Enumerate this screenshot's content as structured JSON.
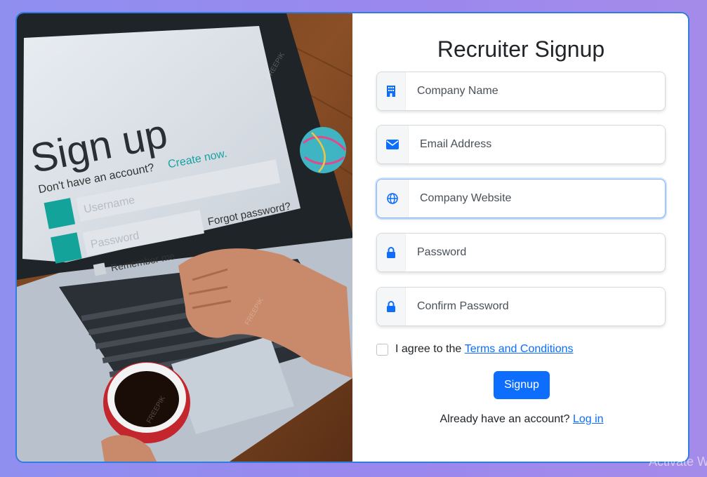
{
  "illustration": {
    "screen_title": "Sign up",
    "screen_subtitle": "Don't have an account?",
    "screen_link": "Create now.",
    "screen_username": "Username",
    "screen_password": "Password",
    "screen_forgot": "Forgot password?",
    "screen_remember": "Remember me",
    "watermark": "FREEPIK"
  },
  "form": {
    "title": "Recruiter Signup",
    "fields": [
      {
        "placeholder": "Company Name",
        "icon": "building-icon"
      },
      {
        "placeholder": "Email Address",
        "icon": "envelope-icon"
      },
      {
        "placeholder": "Company Website",
        "icon": "globe-icon"
      },
      {
        "placeholder": "Password",
        "icon": "lock-icon"
      },
      {
        "placeholder": "Confirm Password",
        "icon": "lock-icon"
      }
    ],
    "agree_text": "I agree to the",
    "terms_link": "Terms and Conditions",
    "signup_button": "Signup",
    "login_prompt": "Already have an account?",
    "login_link": "Log in"
  },
  "colors": {
    "accent": "#0d6efd",
    "card_border": "#2f7de0",
    "background": "#9a88ee"
  },
  "os_watermark": "Activate W"
}
